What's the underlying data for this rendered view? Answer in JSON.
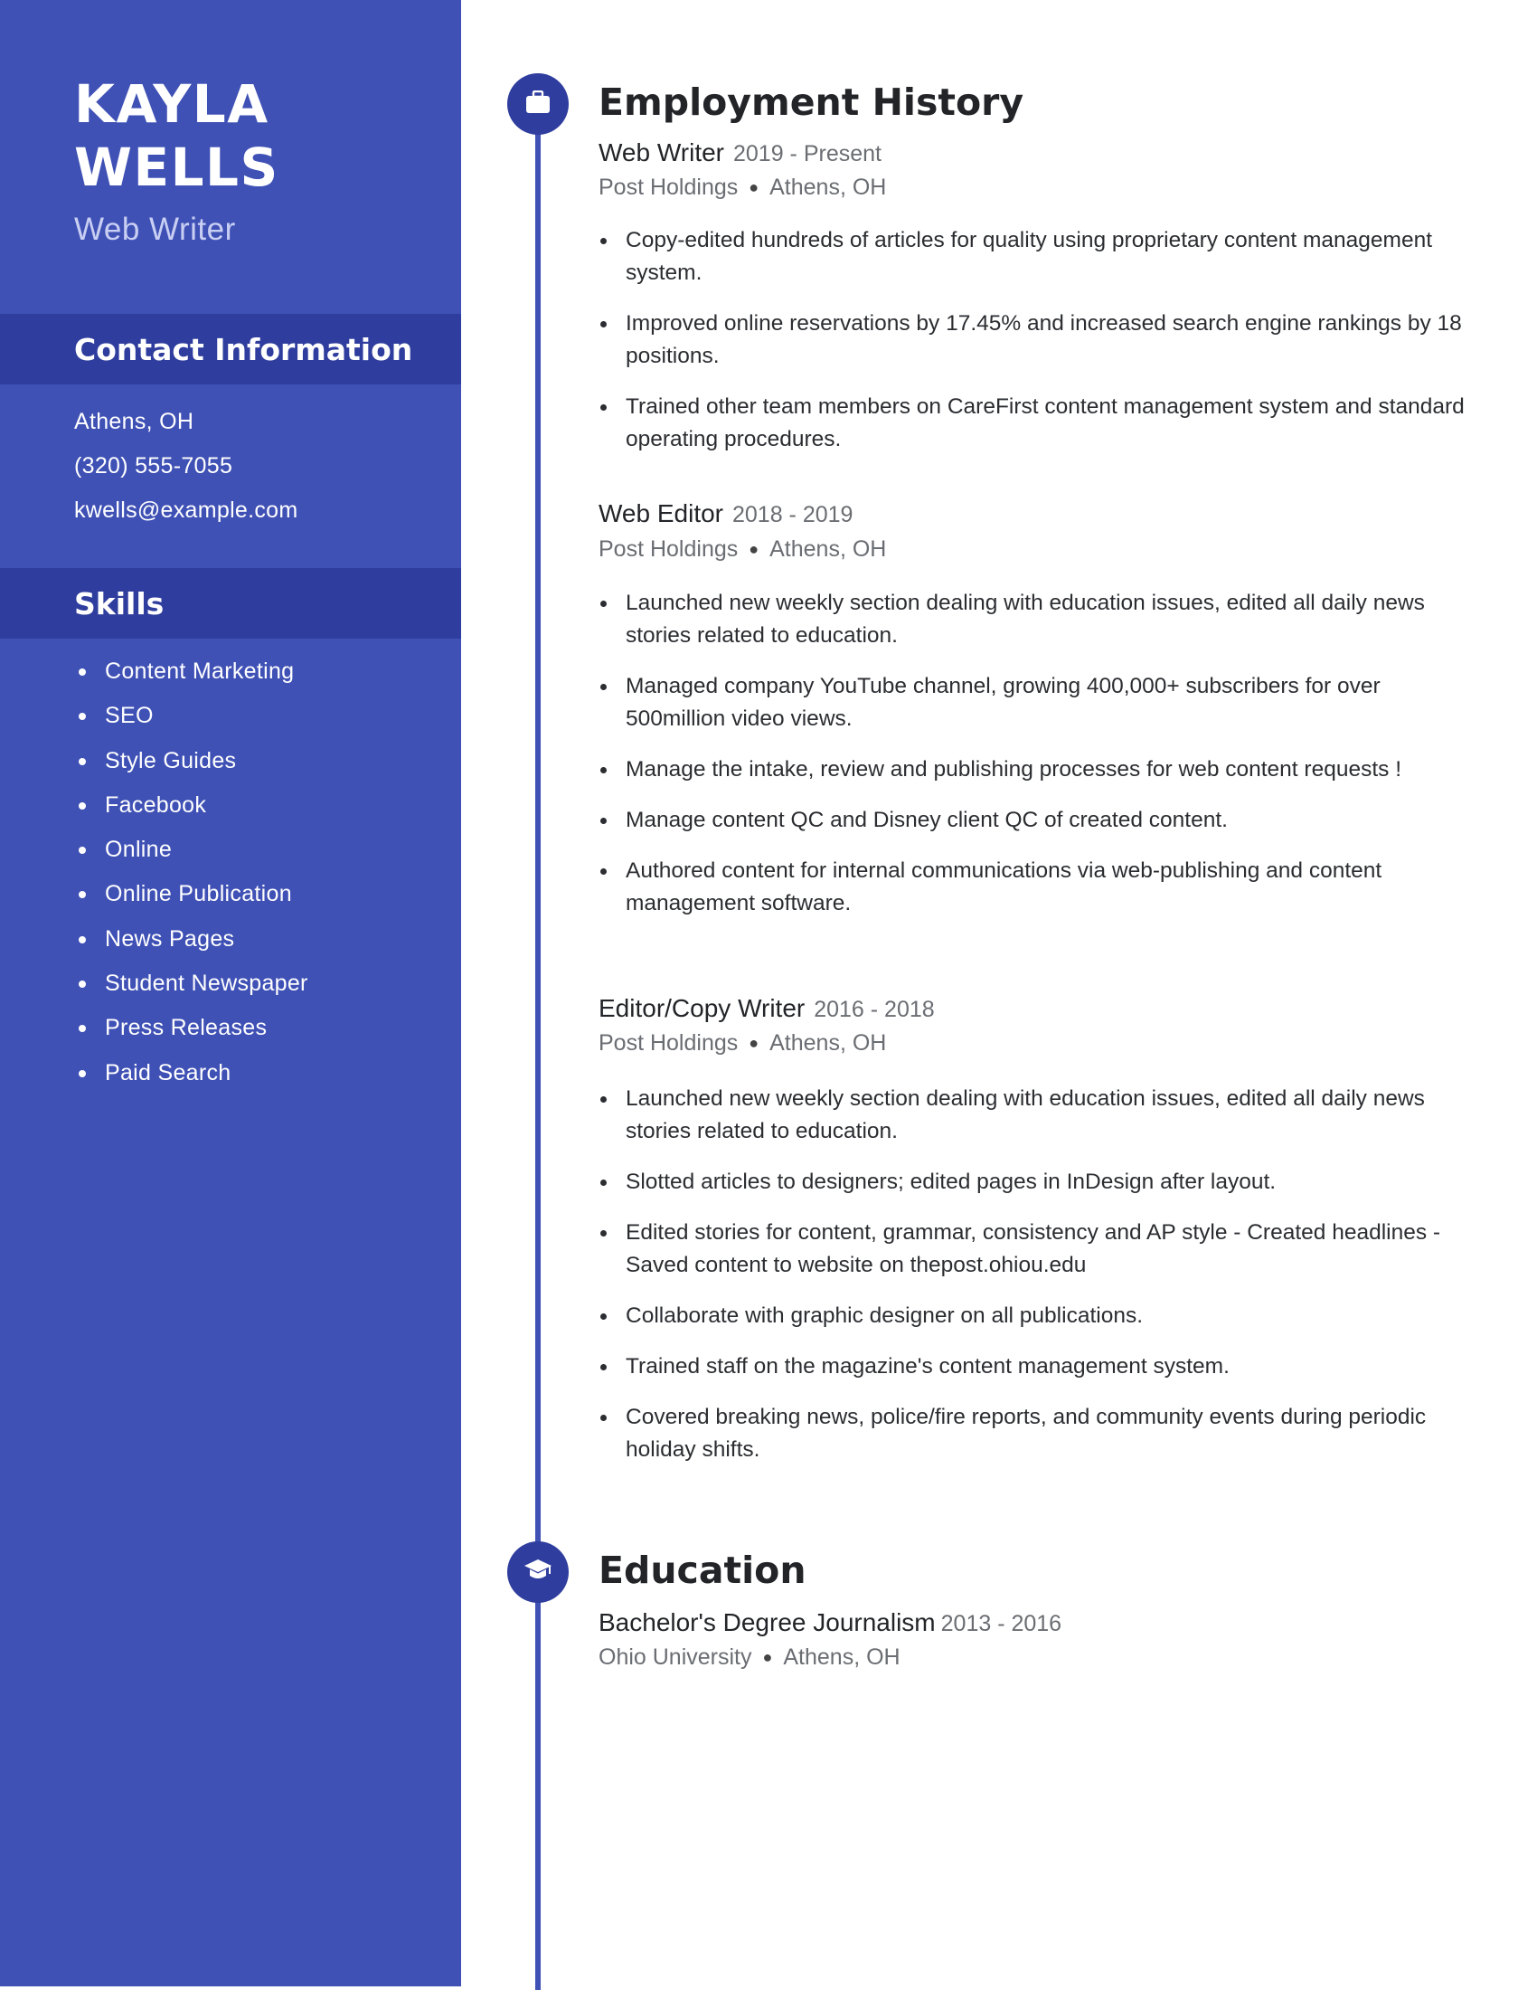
{
  "profile": {
    "first_name": "KAYLA",
    "last_name": "WELLS",
    "title": "Web Writer"
  },
  "colors": {
    "sidebar": "#3f51b5",
    "sidebar_band": "#2f3e9e",
    "accent": "#3f51b5",
    "text_dark": "#222428",
    "text_muted": "#6a6d72"
  },
  "contact": {
    "heading": "Contact Information",
    "items": [
      {
        "type": "location",
        "value": "Athens, OH"
      },
      {
        "type": "phone",
        "value": "(320) 555-7055"
      },
      {
        "type": "email",
        "value": "kwells@example.com"
      }
    ]
  },
  "skills": {
    "heading": "Skills",
    "items": [
      "Content Marketing",
      "SEO",
      "Style Guides",
      "Facebook",
      "Online",
      "Online Publication",
      "News Pages",
      "Student Newspaper",
      "Press Releases",
      "Paid Search"
    ]
  },
  "employment": {
    "heading": "Employment History",
    "icon": "briefcase-icon",
    "jobs": [
      {
        "title": "Web Writer",
        "dates": "2019 - Present",
        "company": "Post Holdings",
        "location": "Athens, OH",
        "bullets": [
          "Copy-edited hundreds of articles for quality using proprietary content management system.",
          "Improved online reservations by 17.45% and increased search engine rankings by 18 positions.",
          "Trained other team members on CareFirst content management system and standard operating procedures."
        ]
      },
      {
        "title": "Web Editor",
        "dates": "2018 - 2019",
        "company": "Post Holdings",
        "location": "Athens, OH",
        "bullets": [
          "Launched new weekly section dealing with education issues, edited all daily news stories related to education.",
          "Managed company YouTube channel, growing 400,000+ subscribers for over 500million video views.",
          "Manage the intake, review and publishing processes for web content requests !",
          "Manage content QC and Disney client QC of created content.",
          "Authored content for internal communications via web-publishing and content management software."
        ]
      },
      {
        "title": "Editor/Copy Writer",
        "dates": "2016 - 2018",
        "company": "Post Holdings",
        "location": "Athens, OH",
        "bullets": [
          "Launched new weekly section dealing with education issues, edited all daily news stories related to education.",
          "Slotted articles to designers; edited pages in InDesign after layout.",
          "Edited stories for content, grammar, consistency and AP style - Created headlines - Saved content to website on thepost.ohiou.edu",
          "Collaborate with graphic designer on all publications.",
          "Trained staff on the magazine's content management system.",
          "Covered breaking news, police/fire reports, and community events during periodic holiday shifts."
        ]
      }
    ]
  },
  "education": {
    "heading": "Education",
    "icon": "graduation-cap-icon",
    "entries": [
      {
        "degree": "Bachelor's Degree Journalism",
        "dates": "2013 - 2016",
        "school": "Ohio University",
        "location": "Athens, OH"
      }
    ]
  }
}
